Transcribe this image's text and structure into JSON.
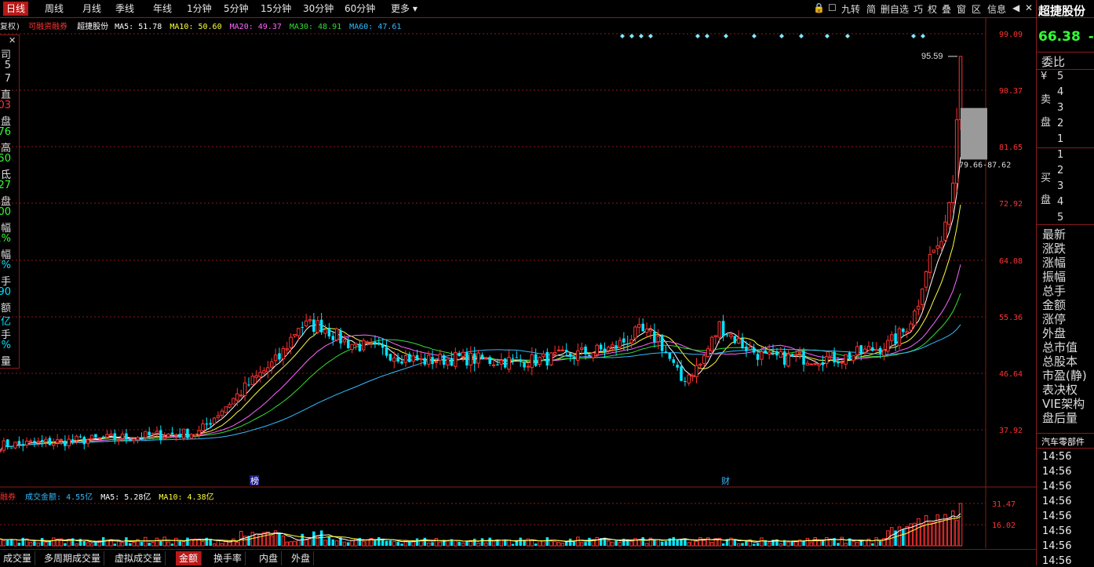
{
  "period_tabs": [
    "日线",
    "周线",
    "月线",
    "季线",
    "年线",
    "1分钟",
    "5分钟",
    "15分钟",
    "30分钟",
    "60分钟",
    "更多 ▾"
  ],
  "active_period": "日线",
  "toolbar": {
    "lock": "🔒",
    "square": "☐",
    "jiuzhuan": "九转",
    "jian": "简",
    "shanzixuan": "删自选",
    "xiang": "巧",
    "quan": "权",
    "die": "叠",
    "chuang": "窗",
    "qu": "区",
    "xinxi": "信息",
    "back": "◀",
    "close": "✕"
  },
  "stock": {
    "name": "超捷股份",
    "price": "66.38",
    "price_suffix": "-",
    "sector": "汽车零部件"
  },
  "legend": {
    "prefix": "复权)",
    "tag": "可融资融券",
    "name": "超捷股份",
    "ma5": "MA5: 51.78",
    "ma10": "MA10: 50.60",
    "ma20": "MA20: 49.37",
    "ma30": "MA30: 48.91",
    "ma60": "MA60: 47.61"
  },
  "vol_legend": {
    "prefix": "融券",
    "amount": "成交金额: 4.55亿",
    "ma5": "MA5: 5.28亿",
    "ma10": "MA10: 4.38亿"
  },
  "left_panel": [
    {
      "t": "司",
      "c": "#dddddd"
    },
    {
      "t": "5",
      "c": "#dddddd"
    },
    {
      "t": "7",
      "c": "#dddddd"
    },
    {
      "t": "直",
      "c": "#dddddd"
    },
    {
      "t": "03",
      "c": "#ff3333"
    },
    {
      "t": "盘",
      "c": "#dddddd"
    },
    {
      "t": "76",
      "c": "#33ff33"
    },
    {
      "t": "高",
      "c": "#dddddd"
    },
    {
      "t": "50",
      "c": "#33ff33"
    },
    {
      "t": "氐",
      "c": "#dddddd"
    },
    {
      "t": "27",
      "c": "#33ff33"
    },
    {
      "t": "盘",
      "c": "#dddddd"
    },
    {
      "t": "00",
      "c": "#33ff33"
    },
    {
      "t": "幅",
      "c": "#dddddd"
    },
    {
      "t": "1%",
      "c": "#33ff33"
    },
    {
      "t": "幅",
      "c": "#dddddd"
    },
    {
      "t": "%",
      "c": "#00e5ff"
    },
    {
      "t": "手",
      "c": "#dddddd"
    },
    {
      "t": "90",
      "c": "#00e5ff"
    },
    {
      "t": "额",
      "c": "#dddddd"
    },
    {
      "t": "1亿",
      "c": "#00e5ff"
    },
    {
      "t": "手",
      "c": "#dddddd"
    },
    {
      "t": "%",
      "c": "#00e5ff"
    },
    {
      "t": "量",
      "c": "#dddddd"
    },
    {
      "t": "额",
      "c": "#dddddd"
    }
  ],
  "left_panel_close": "✕",
  "price_axis": [
    "99.09",
    "90.37",
    "81.65",
    "72.92",
    "64.08",
    "55.36",
    "46.64",
    "37.92"
  ],
  "vol_axis": [
    "31.47",
    "16.02"
  ],
  "annotations": {
    "high_label": "95.59",
    "range_label": "79.66-87.62",
    "marker_bang": "榜",
    "marker_cai": "财"
  },
  "right_panel": {
    "weibi": "委比",
    "sell_side": [
      "¥",
      "卖",
      "盘"
    ],
    "sell_levels": [
      "5",
      "4",
      "3",
      "2",
      "1"
    ],
    "buy_side": [
      "买",
      "盘"
    ],
    "buy_levels": [
      "1",
      "2",
      "3",
      "4",
      "5"
    ],
    "fields": [
      "最新",
      "涨跌",
      "涨幅",
      "振幅",
      "总手",
      "金额",
      "涨停",
      "外盘",
      "总市值",
      "总股本",
      "市盈(静)",
      "表决权",
      "VIE架构",
      "盘后量"
    ],
    "ticks": [
      "14:56",
      "14:56",
      "14:56",
      "14:56",
      "14:56",
      "14:56",
      "14:56",
      "14:56"
    ]
  },
  "bottom_tabs": [
    "成交量",
    "多周期成交量",
    "虚拟成交量",
    "金额",
    "换手率",
    "内盘",
    "外盘"
  ],
  "active_bottom_tab": "金额",
  "colors": {
    "up": "#ff3232",
    "down": "#00e5ff",
    "ma5": "#ffffff",
    "ma10": "#ffff3c",
    "ma20": "#ff66ff",
    "ma30": "#33dd33",
    "ma60": "#33bbff",
    "grid": "#8a1a1a",
    "accent": "#b81818"
  }
}
